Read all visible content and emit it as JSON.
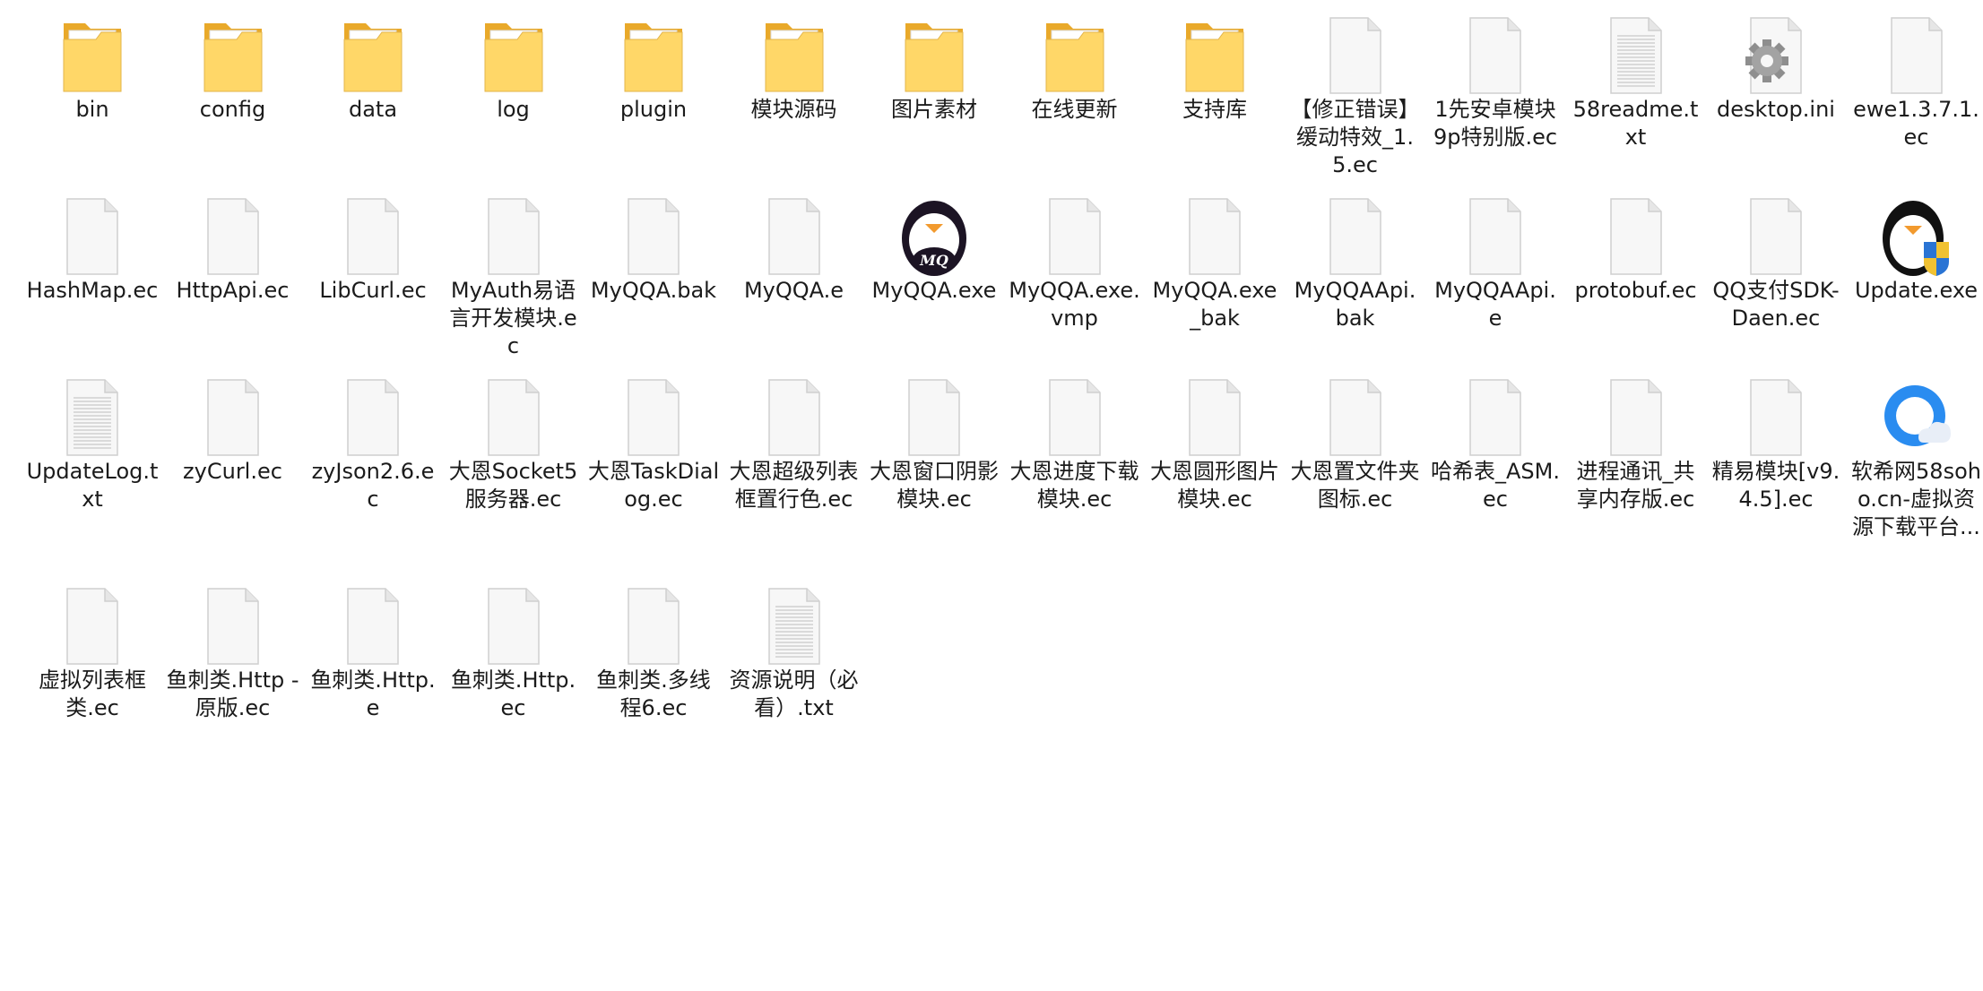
{
  "colors": {
    "background": "#ffffff",
    "text": "#1b1b1b",
    "folder_front": "#FFD768",
    "folder_back": "#E9A92A"
  },
  "items": [
    {
      "label": "bin",
      "icon": "folder-icon"
    },
    {
      "label": "config",
      "icon": "folder-icon"
    },
    {
      "label": "data",
      "icon": "folder-icon"
    },
    {
      "label": "log",
      "icon": "folder-icon"
    },
    {
      "label": "plugin",
      "icon": "folder-icon"
    },
    {
      "label": "模块源码",
      "icon": "folder-icon"
    },
    {
      "label": "图片素材",
      "icon": "folder-icon"
    },
    {
      "label": "在线更新",
      "icon": "folder-icon"
    },
    {
      "label": "支持库",
      "icon": "folder-icon"
    },
    {
      "label": "【修正错误】缓动特效_1.5.ec",
      "icon": "file-icon"
    },
    {
      "label": "1先安卓模块9p特别版.ec",
      "icon": "file-icon"
    },
    {
      "label": "58readme.txt",
      "icon": "text-file-icon"
    },
    {
      "label": "desktop.ini",
      "icon": "settings-file-icon"
    },
    {
      "label": "ewe1.3.7.1.ec",
      "icon": "file-icon"
    },
    {
      "label": "HashMap.ec",
      "icon": "file-icon"
    },
    {
      "label": "HttpApi.ec",
      "icon": "file-icon"
    },
    {
      "label": "LibCurl.ec",
      "icon": "file-icon"
    },
    {
      "label": "MyAuth易语言开发模块.ec",
      "icon": "file-icon"
    },
    {
      "label": "MyQQA.bak",
      "icon": "file-icon"
    },
    {
      "label": "MyQQA.e",
      "icon": "file-icon"
    },
    {
      "label": "MyQQA.exe",
      "icon": "myqq-app-icon"
    },
    {
      "label": "MyQQA.exe.vmp",
      "icon": "file-icon"
    },
    {
      "label": "MyQQA.exe_bak",
      "icon": "file-icon"
    },
    {
      "label": "MyQQAApi.bak",
      "icon": "file-icon"
    },
    {
      "label": "MyQQAApi.e",
      "icon": "file-icon"
    },
    {
      "label": "protobuf.ec",
      "icon": "file-icon"
    },
    {
      "label": "QQ支付SDK-Daen.ec",
      "icon": "file-icon"
    },
    {
      "label": "Update.exe",
      "icon": "update-app-icon"
    },
    {
      "label": "UpdateLog.txt",
      "icon": "text-file-icon"
    },
    {
      "label": "zyCurl.ec",
      "icon": "file-icon"
    },
    {
      "label": "zyJson2.6.ec",
      "icon": "file-icon"
    },
    {
      "label": "大恩Socket5服务器.ec",
      "icon": "file-icon"
    },
    {
      "label": "大恩TaskDialog.ec",
      "icon": "file-icon"
    },
    {
      "label": "大恩超级列表框置行色.ec",
      "icon": "file-icon"
    },
    {
      "label": "大恩窗口阴影模块.ec",
      "icon": "file-icon"
    },
    {
      "label": "大恩进度下载模块.ec",
      "icon": "file-icon"
    },
    {
      "label": "大恩圆形图片模块.ec",
      "icon": "file-icon"
    },
    {
      "label": "大恩置文件夹图标.ec",
      "icon": "file-icon"
    },
    {
      "label": "哈希表_ASM.ec",
      "icon": "file-icon"
    },
    {
      "label": "进程通讯_共享内存版.ec",
      "icon": "file-icon"
    },
    {
      "label": "精易模块[v9.4.5].ec",
      "icon": "file-icon"
    },
    {
      "label": "软希网58soho.cn-虚拟资源下载平台...",
      "icon": "browser-link-icon"
    },
    {
      "label": "虚拟列表框类.ec",
      "icon": "file-icon"
    },
    {
      "label": "鱼刺类.Http - 原版.ec",
      "icon": "file-icon"
    },
    {
      "label": "鱼刺类.Http.e",
      "icon": "file-icon"
    },
    {
      "label": "鱼刺类.Http.ec",
      "icon": "file-icon"
    },
    {
      "label": "鱼刺类.多线程6.ec",
      "icon": "file-icon"
    },
    {
      "label": "资源说明（必看）.txt",
      "icon": "text-file-icon"
    }
  ]
}
